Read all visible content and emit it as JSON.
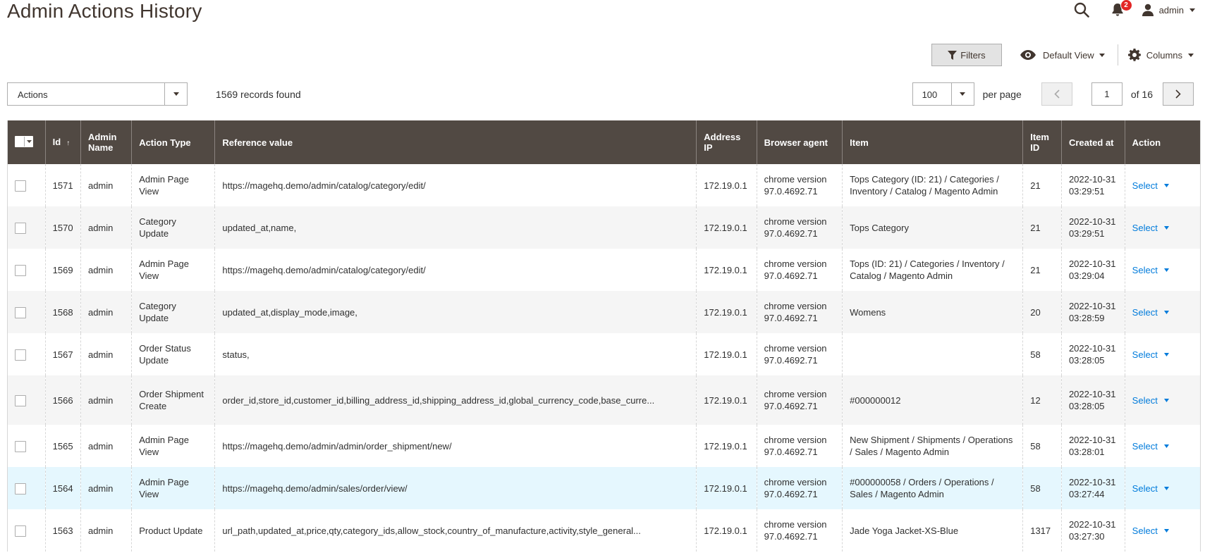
{
  "page": {
    "title": "Admin Actions History"
  },
  "header": {
    "notifications_count": "2",
    "user_name": "admin"
  },
  "toolbar": {
    "filters_label": "Filters",
    "view_label": "Default View",
    "columns_label": "Columns",
    "actions_label": "Actions",
    "records_found": "1569 records found",
    "per_page_value": "100",
    "per_page_label": "per page",
    "current_page": "1",
    "page_of": "of 16"
  },
  "table": {
    "columns": [
      "Id",
      "Admin Name",
      "Action Type",
      "Reference value",
      "Address IP",
      "Browser agent",
      "Item",
      "Item ID",
      "Created at",
      "Action"
    ],
    "sort_indicator": "↑",
    "rows": [
      {
        "id": "1571",
        "admin": "admin",
        "type": "Admin Page View",
        "ref": "https://magehq.demo/admin/catalog/category/edit/",
        "ip": "172.19.0.1",
        "agent": "chrome version 97.0.4692.71",
        "item": "Tops Category (ID: 21) / Categories / Inventory / Catalog / Magento Admin",
        "item_id": "21",
        "created": "2022-10-31 03:29:51",
        "action": "Select"
      },
      {
        "id": "1570",
        "admin": "admin",
        "type": "Category Update",
        "ref": "updated_at,name,",
        "ip": "172.19.0.1",
        "agent": "chrome version 97.0.4692.71",
        "item": "Tops Category",
        "item_id": "21",
        "created": "2022-10-31 03:29:51",
        "action": "Select"
      },
      {
        "id": "1569",
        "admin": "admin",
        "type": "Admin Page View",
        "ref": "https://magehq.demo/admin/catalog/category/edit/",
        "ip": "172.19.0.1",
        "agent": "chrome version 97.0.4692.71",
        "item": "Tops (ID: 21) / Categories / Inventory / Catalog / Magento Admin",
        "item_id": "21",
        "created": "2022-10-31 03:29:04",
        "action": "Select"
      },
      {
        "id": "1568",
        "admin": "admin",
        "type": "Category Update",
        "ref": "updated_at,display_mode,image,",
        "ip": "172.19.0.1",
        "agent": "chrome version 97.0.4692.71",
        "item": "Womens",
        "item_id": "20",
        "created": "2022-10-31 03:28:59",
        "action": "Select"
      },
      {
        "id": "1567",
        "admin": "admin",
        "type": "Order Status Update",
        "ref": "status,",
        "ip": "172.19.0.1",
        "agent": "chrome version 97.0.4692.71",
        "item": "",
        "item_id": "58",
        "created": "2022-10-31 03:28:05",
        "action": "Select"
      },
      {
        "id": "1566",
        "admin": "admin",
        "type": "Order Shipment Create",
        "ref": "order_id,store_id,customer_id,billing_address_id,shipping_address_id,global_currency_code,base_curre...",
        "ip": "172.19.0.1",
        "agent": "chrome version 97.0.4692.71",
        "item": "#000000012",
        "item_id": "12",
        "created": "2022-10-31 03:28:05",
        "action": "Select"
      },
      {
        "id": "1565",
        "admin": "admin",
        "type": "Admin Page View",
        "ref": "https://magehq.demo/admin/admin/order_shipment/new/",
        "ip": "172.19.0.1",
        "agent": "chrome version 97.0.4692.71",
        "item": "New Shipment / Shipments / Operations / Sales / Magento Admin",
        "item_id": "58",
        "created": "2022-10-31 03:28:01",
        "action": "Select"
      },
      {
        "id": "1564",
        "admin": "admin",
        "type": "Admin Page View",
        "ref": "https://magehq.demo/admin/sales/order/view/",
        "ip": "172.19.0.1",
        "agent": "chrome version 97.0.4692.71",
        "item": "#000000058 / Orders / Operations / Sales / Magento Admin",
        "item_id": "58",
        "created": "2022-10-31 03:27:44",
        "action": "Select"
      },
      {
        "id": "1563",
        "admin": "admin",
        "type": "Product Update",
        "ref": "url_path,updated_at,price,qty,category_ids,allow_stock,country_of_manufacture,activity,style_general...",
        "ip": "172.19.0.1",
        "agent": "chrome version 97.0.4692.71",
        "item": "Jade Yoga Jacket-XS-Blue",
        "item_id": "1317",
        "created": "2022-10-31 03:27:30",
        "action": "Select"
      }
    ]
  },
  "colors": {
    "header_bg": "#514943",
    "link": "#007bdb",
    "badge": "#e22626",
    "highlight_row": "#e5f7fe"
  }
}
